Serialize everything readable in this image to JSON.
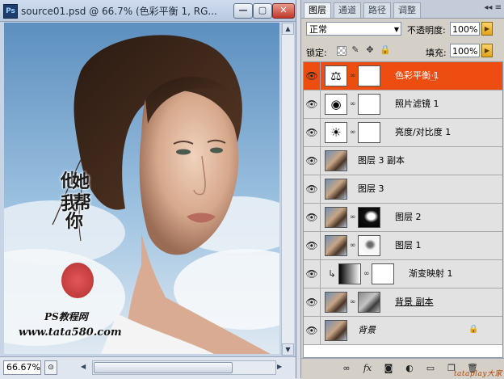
{
  "document": {
    "app_logo": "Ps",
    "title": "source01.psd @ 66.7% (色彩平衡 1, RG...",
    "buttons": {
      "minimize": "—",
      "maximize": "▢",
      "close": "✕"
    },
    "zoom": "66.67%",
    "watermark": {
      "calligraphy_chars": [
        "他",
        "她",
        "我",
        "帮",
        "你"
      ],
      "line1": "PS教程网",
      "line2": "www.tata580.com"
    }
  },
  "panel": {
    "tabs": [
      {
        "label": "图层",
        "active": true
      },
      {
        "label": "通道",
        "active": false
      },
      {
        "label": "路径",
        "active": false
      },
      {
        "label": "调整",
        "active": false
      }
    ],
    "blend_mode": "正常",
    "opacity_label": "不透明度:",
    "opacity_value": "100%",
    "lock_label": "锁定:",
    "fill_label": "填充:",
    "fill_value": "100%",
    "layers": [
      {
        "name": "色彩平衡 1",
        "thumb": "adjustment-balance",
        "mask": "white",
        "selected": true
      },
      {
        "name": "照片滤镜 1",
        "thumb": "adjustment-photo-filter",
        "mask": "white",
        "selected": false
      },
      {
        "name": "亮度/对比度 1",
        "thumb": "adjustment-brightness",
        "mask": "white",
        "selected": false
      },
      {
        "name": "图层 3 副本",
        "thumb": "photo",
        "mask": null,
        "selected": false
      },
      {
        "name": "图层 3",
        "thumb": "photo",
        "mask": null,
        "selected": false
      },
      {
        "name": "图层 2",
        "thumb": "photo",
        "mask": "dark",
        "selected": false
      },
      {
        "name": "图层 1",
        "thumb": "photo",
        "mask": "sketch",
        "selected": false
      },
      {
        "name": "渐变映射 1",
        "thumb": "gradient",
        "mask": "white",
        "selected": false,
        "clipped": true
      },
      {
        "name": "背景 副本",
        "thumb": "photo",
        "mask": "sketch-gray",
        "selected": false,
        "underline": true
      },
      {
        "name": "背景",
        "thumb": "photo",
        "mask": null,
        "selected": false,
        "italic": true,
        "locked": true
      }
    ],
    "footer_watermark": "tataplay大家"
  },
  "colors": {
    "selected_layer": "#ee4d12",
    "flyout": "#f0b53a",
    "title_bar": "#c3d1e6"
  },
  "icons": {
    "visibility": "eye-icon",
    "chain": "chain-link-icon",
    "balance": "scale-icon",
    "camera": "camera-icon",
    "brightness": "sun-icon",
    "lock": "lock-icon"
  }
}
